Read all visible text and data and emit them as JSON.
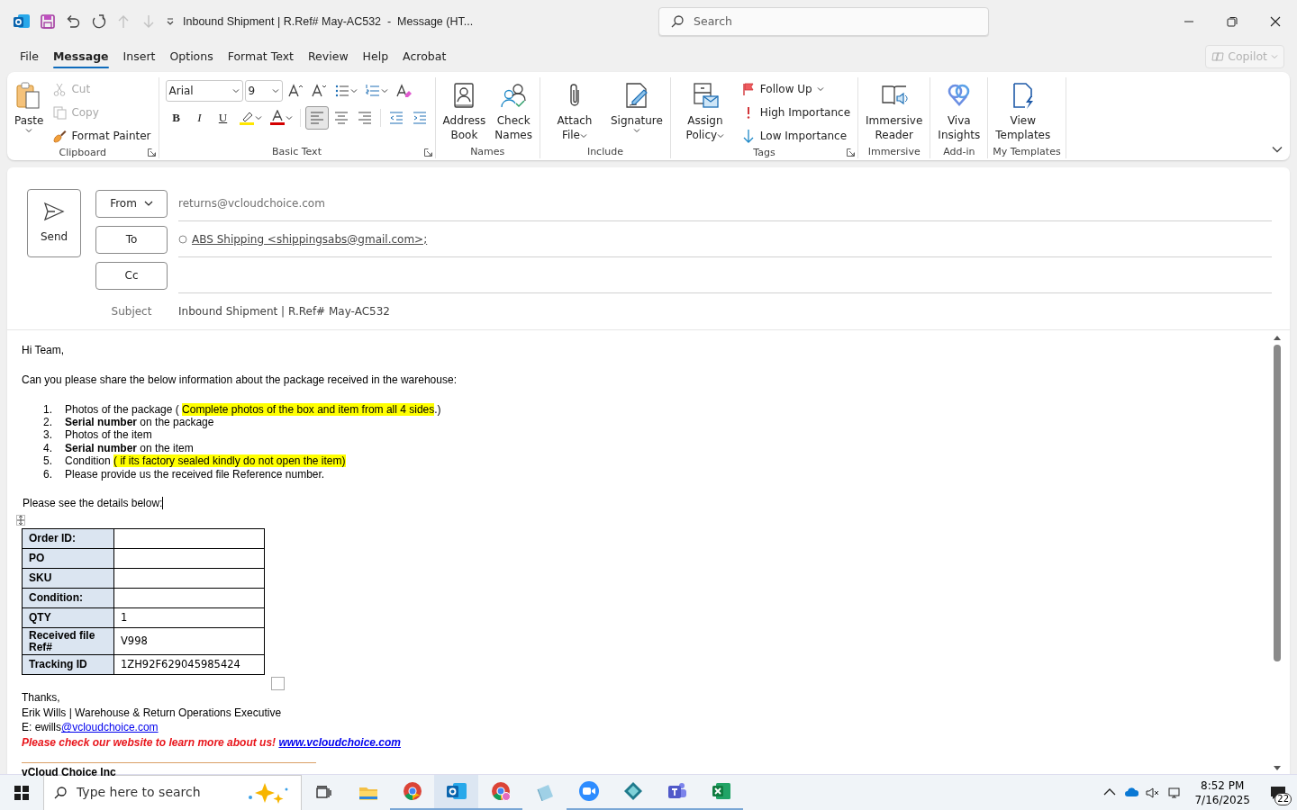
{
  "window": {
    "title": "Inbound Shipment | R.Ref# May-AC532  -  Message (HT...",
    "search_placeholder": "Search"
  },
  "tabs": [
    {
      "label": "File",
      "selected": false
    },
    {
      "label": "Message",
      "selected": true
    },
    {
      "label": "Insert",
      "selected": false
    },
    {
      "label": "Options",
      "selected": false
    },
    {
      "label": "Format Text",
      "selected": false
    },
    {
      "label": "Review",
      "selected": false
    },
    {
      "label": "Help",
      "selected": false
    },
    {
      "label": "Acrobat",
      "selected": false
    }
  ],
  "copilot": {
    "label": "Copilot",
    "disabled": true
  },
  "ribbon": [
    {
      "kind": "buttons",
      "label": "Clipboard",
      "launcher": true,
      "items": [
        {
          "kind": "large",
          "label": "Paste",
          "dropdown": true,
          "disabled": false
        },
        {
          "kind": "small",
          "label": "Cut",
          "dropdown": false,
          "disabled": true
        },
        {
          "kind": "small",
          "label": "Copy",
          "dropdown": false,
          "disabled": true
        },
        {
          "kind": "small",
          "label": "Format Painter",
          "dropdown": false,
          "disabled": false
        }
      ]
    },
    {
      "kind": "text_format",
      "label": "Basic Text",
      "launcher": true,
      "font": "Arial",
      "size": "9",
      "format_buttons": [
        {
          "label": "B",
          "selected": false
        },
        {
          "label": "I",
          "selected": false
        },
        {
          "label": "U",
          "selected": false
        }
      ],
      "align_buttons": [
        {
          "selected": true
        },
        {
          "selected": false
        },
        {
          "selected": false
        }
      ]
    },
    {
      "kind": "buttons",
      "label": "Names",
      "items": [
        {
          "kind": "large",
          "label": "Address Book",
          "dropdown": false,
          "disabled": false
        },
        {
          "kind": "large",
          "label": "Check Names",
          "dropdown": false,
          "disabled": false
        }
      ]
    },
    {
      "kind": "buttons",
      "label": "Include",
      "items": [
        {
          "kind": "large",
          "label": "Attach File",
          "dropdown": true,
          "disabled": false
        },
        {
          "kind": "large",
          "label": "Signature",
          "dropdown": true,
          "disabled": false
        }
      ]
    },
    {
      "kind": "buttons",
      "label": "Tags",
      "launcher": true,
      "items": [
        {
          "kind": "large",
          "label": "Assign Policy",
          "dropdown": true,
          "disabled": false
        },
        {
          "kind": "small",
          "label": "Follow Up",
          "dropdown": true,
          "disabled": false
        },
        {
          "kind": "small",
          "label": "High Importance",
          "dropdown": false,
          "disabled": false
        },
        {
          "kind": "small",
          "label": "Low Importance",
          "dropdown": false,
          "disabled": false
        }
      ]
    },
    {
      "kind": "buttons",
      "label": "Immersive",
      "items": [
        {
          "kind": "large",
          "label": "Immersive Reader",
          "dropdown": false,
          "disabled": false
        }
      ]
    },
    {
      "kind": "buttons",
      "label": "Add-in",
      "items": [
        {
          "kind": "large",
          "label": "Viva Insights",
          "dropdown": false,
          "disabled": false
        }
      ]
    },
    {
      "kind": "buttons",
      "label": "My Templates",
      "items": [
        {
          "kind": "large",
          "label": "View Templates",
          "dropdown": false,
          "disabled": false
        }
      ]
    }
  ],
  "compose": {
    "send": "Send",
    "fields": [
      {
        "kind": "dropdown",
        "button": "From",
        "value": "returns@vcloudchoice.com"
      },
      {
        "kind": "address",
        "button": "To",
        "recipient": "ABS Shipping <shippingsabs@gmail.com>;"
      },
      {
        "kind": "address",
        "button": "Cc"
      }
    ],
    "subject_label": "Subject",
    "subject": "Inbound Shipment | R.Ref# May-AC532"
  },
  "body": {
    "greeting": "Hi Team,",
    "intro": "Can you please share the below information about the package received in the warehouse:",
    "list": [
      {
        "number": "1.",
        "segments": [
          {
            "text": "Photos of the package ( ",
            "kind": "plain"
          },
          {
            "text": "Complete photos of the box and item from all 4 sides",
            "kind": "highlight"
          },
          {
            "text": ".)",
            "kind": "plain"
          }
        ]
      },
      {
        "number": "2.",
        "segments": [
          {
            "text": "Serial number",
            "kind": "bold"
          },
          {
            "text": " on the package",
            "kind": "plain"
          }
        ]
      },
      {
        "number": "3.",
        "segments": [
          {
            "text": "Photos of the item",
            "kind": "plain"
          }
        ]
      },
      {
        "number": "4.",
        "segments": [
          {
            "text": "Serial number",
            "kind": "bold"
          },
          {
            "text": " on the item",
            "kind": "plain"
          }
        ]
      },
      {
        "number": "5.",
        "segments": [
          {
            "text": "Condition ",
            "kind": "plain"
          },
          {
            "text": "( if its factory sealed kindly do not open the item)",
            "kind": "highlight"
          }
        ]
      },
      {
        "number": "6.",
        "segments": [
          {
            "text": "Please provide us the received file Reference number.",
            "kind": "plain"
          }
        ]
      }
    ],
    "details_intro": "Please see the details below:",
    "table": [
      {
        "label": "Order ID:"
      },
      {
        "label": "PO"
      },
      {
        "label": "SKU"
      },
      {
        "label": "Condition:"
      },
      {
        "label": "QTY",
        "value": "1"
      },
      {
        "label": "Received file Ref#",
        "value": "V998"
      },
      {
        "label": "Tracking ID",
        "value": "1ZH92F629045985424"
      }
    ],
    "closing": "Thanks,",
    "signer": "Erik Wills | Warehouse & Return Operations Executive",
    "email_prefix": "E: ewills",
    "email_link": "@vcloudchoice.com",
    "promo": "Please check our website to learn more about us!",
    "website": "www.vcloudchoice.com",
    "company": "vCloud Choice Inc"
  },
  "taskbar": {
    "search_placeholder": "Type here to search",
    "apps": [
      {
        "running": false,
        "selected": false
      },
      {
        "running": true,
        "selected": false
      },
      {
        "running": true,
        "selected": true
      },
      {
        "running": true,
        "selected": false
      },
      {
        "running": false,
        "selected": false
      },
      {
        "running": true,
        "selected": false
      },
      {
        "running": true,
        "selected": false
      },
      {
        "running": true,
        "selected": false
      },
      {
        "running": true,
        "selected": false
      }
    ],
    "time": "8:52 PM",
    "date": "7/16/2025",
    "notifications": "22"
  }
}
